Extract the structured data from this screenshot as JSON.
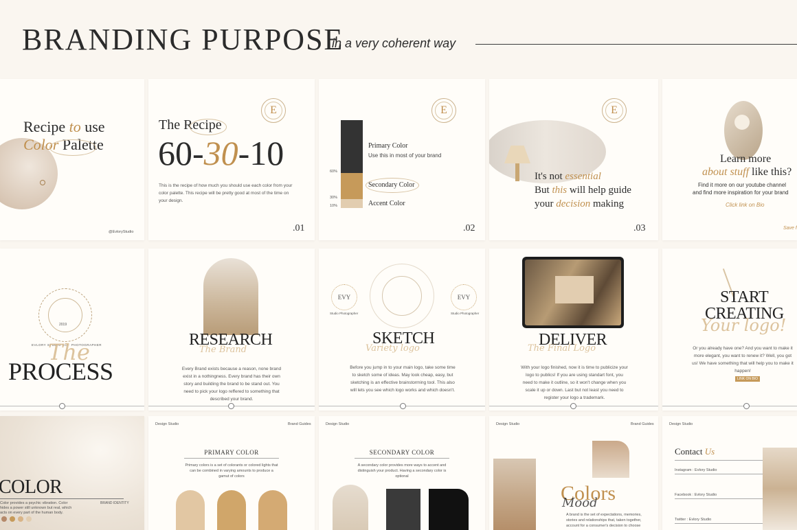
{
  "header": {
    "title": "BRANDING PURPOSE",
    "subtitle": "in a very coherent way"
  },
  "card1": {
    "title_a": "Recipe ",
    "title_b": "to",
    "title_c": " use",
    "title_d": "Color",
    "title_e": " Palette",
    "handle": "@EvloryStudio"
  },
  "card2": {
    "heading": "The Recipe",
    "n1": "60-",
    "n2": "30",
    "n3": "-10",
    "body": "This is the recipe of how much you should use each color from your color palette. This recipe will be pretty good at most of the time on your design.",
    "page": ".01",
    "seal": "E"
  },
  "card3": {
    "primary_label": "Primary Color",
    "primary_desc": "Use this in most of your brand",
    "secondary_label": "Secondary Color",
    "accent_label": "Accent Color",
    "pct60": "60%",
    "pct30": "30%",
    "pct10": "10%",
    "page": ".02",
    "seal": "E"
  },
  "card4": {
    "l1a": "It's not ",
    "l1b": "essential",
    "l2a": "But ",
    "l2b": "this",
    "l2c": " will help guide",
    "l3a": "your ",
    "l3b": "decision",
    "l3c": " making",
    "page": ".03",
    "seal": "E"
  },
  "card5": {
    "l1": "Learn more",
    "l2a": "about stuff",
    "l2b": " like this?",
    "desc1": "Find it more on our youtube channel",
    "desc2": "and find more inspiration for your brand",
    "link": "Click link on Bio",
    "save": "Save f"
  },
  "card6": {
    "script": "The",
    "title": "PROCESS",
    "seal_text": "EVLORY STUDIO CO · PHOTOGRAPHER",
    "year": "2019"
  },
  "card7": {
    "title": "RESEARCH",
    "script": "The Brand",
    "body": "Every Brand exists because a reason, none brand exist in a nothingness. Every brand has their own story and building the brand to be stand out. You need to pick your logo reffered to something that described your brand."
  },
  "card8": {
    "title": "SKETCH",
    "script": "Variety logo",
    "badge": "EVY",
    "badge_sub": "Studio Photographer",
    "body": "Before you jump in to your main logo, take some time to sketch some of ideas. May look cheap, easy, but sketching is an effective brainstorming tool. This also will lets you see which logo works and which doesn't."
  },
  "card9": {
    "title": "DELIVER",
    "script": "The Final Logo",
    "body": "With your logo finished, now it is time to publicize your logo to publics! If you are using standart font, you need to make it outline, so it won't change when you scale it up or down. Last but not least you need to register your logo a trademark."
  },
  "card10": {
    "l1": "START",
    "l2": "CREATING",
    "script": "Your logo!",
    "body": "Or you already have one? And you want to make it more elegant, you want to renew it? Well, you got us! We have something that will help you to make it happen!",
    "button": "LINK ON BIO"
  },
  "card11": {
    "title": "COLOR",
    "desc": "Color provides a psychic vibration. Color hides a power still unknown but real, which acts on every part of the human body.",
    "tag": "BRAND IDENTITY"
  },
  "card12": {
    "left": "Design Studio",
    "right": "Brand Guides",
    "title": "PRIMARY COLOR",
    "desc": "Primary colors is a set of colorants or colored lights that can be combined in varying amounts to produce a gamut of colors"
  },
  "card13": {
    "left": "Design Studio",
    "title": "SECONDARY COLOR",
    "desc": "A secondary color provides more ways to accent and distinguish your product. Having a secondary color is optional"
  },
  "card14": {
    "left": "Design Studio",
    "right": "Brand Guides",
    "title": "Colors",
    "script": "Mood",
    "desc": "A brand is the set of expectations, memories, stories and relationships that, taken together, account for a consumer's decision to choose"
  },
  "card15": {
    "left": "Design Studio",
    "title_a": "Contact ",
    "title_b": "Us",
    "instagram": "Instagram : Evlory Studio",
    "facebook": "Facebook : Evlory Studio",
    "twitter": "Twitter : Evlory Studio"
  },
  "colors": {
    "gold": "#c0904f",
    "dark": "#333333",
    "sand": "#e2cdb0",
    "caramel": "#c69a5a"
  }
}
